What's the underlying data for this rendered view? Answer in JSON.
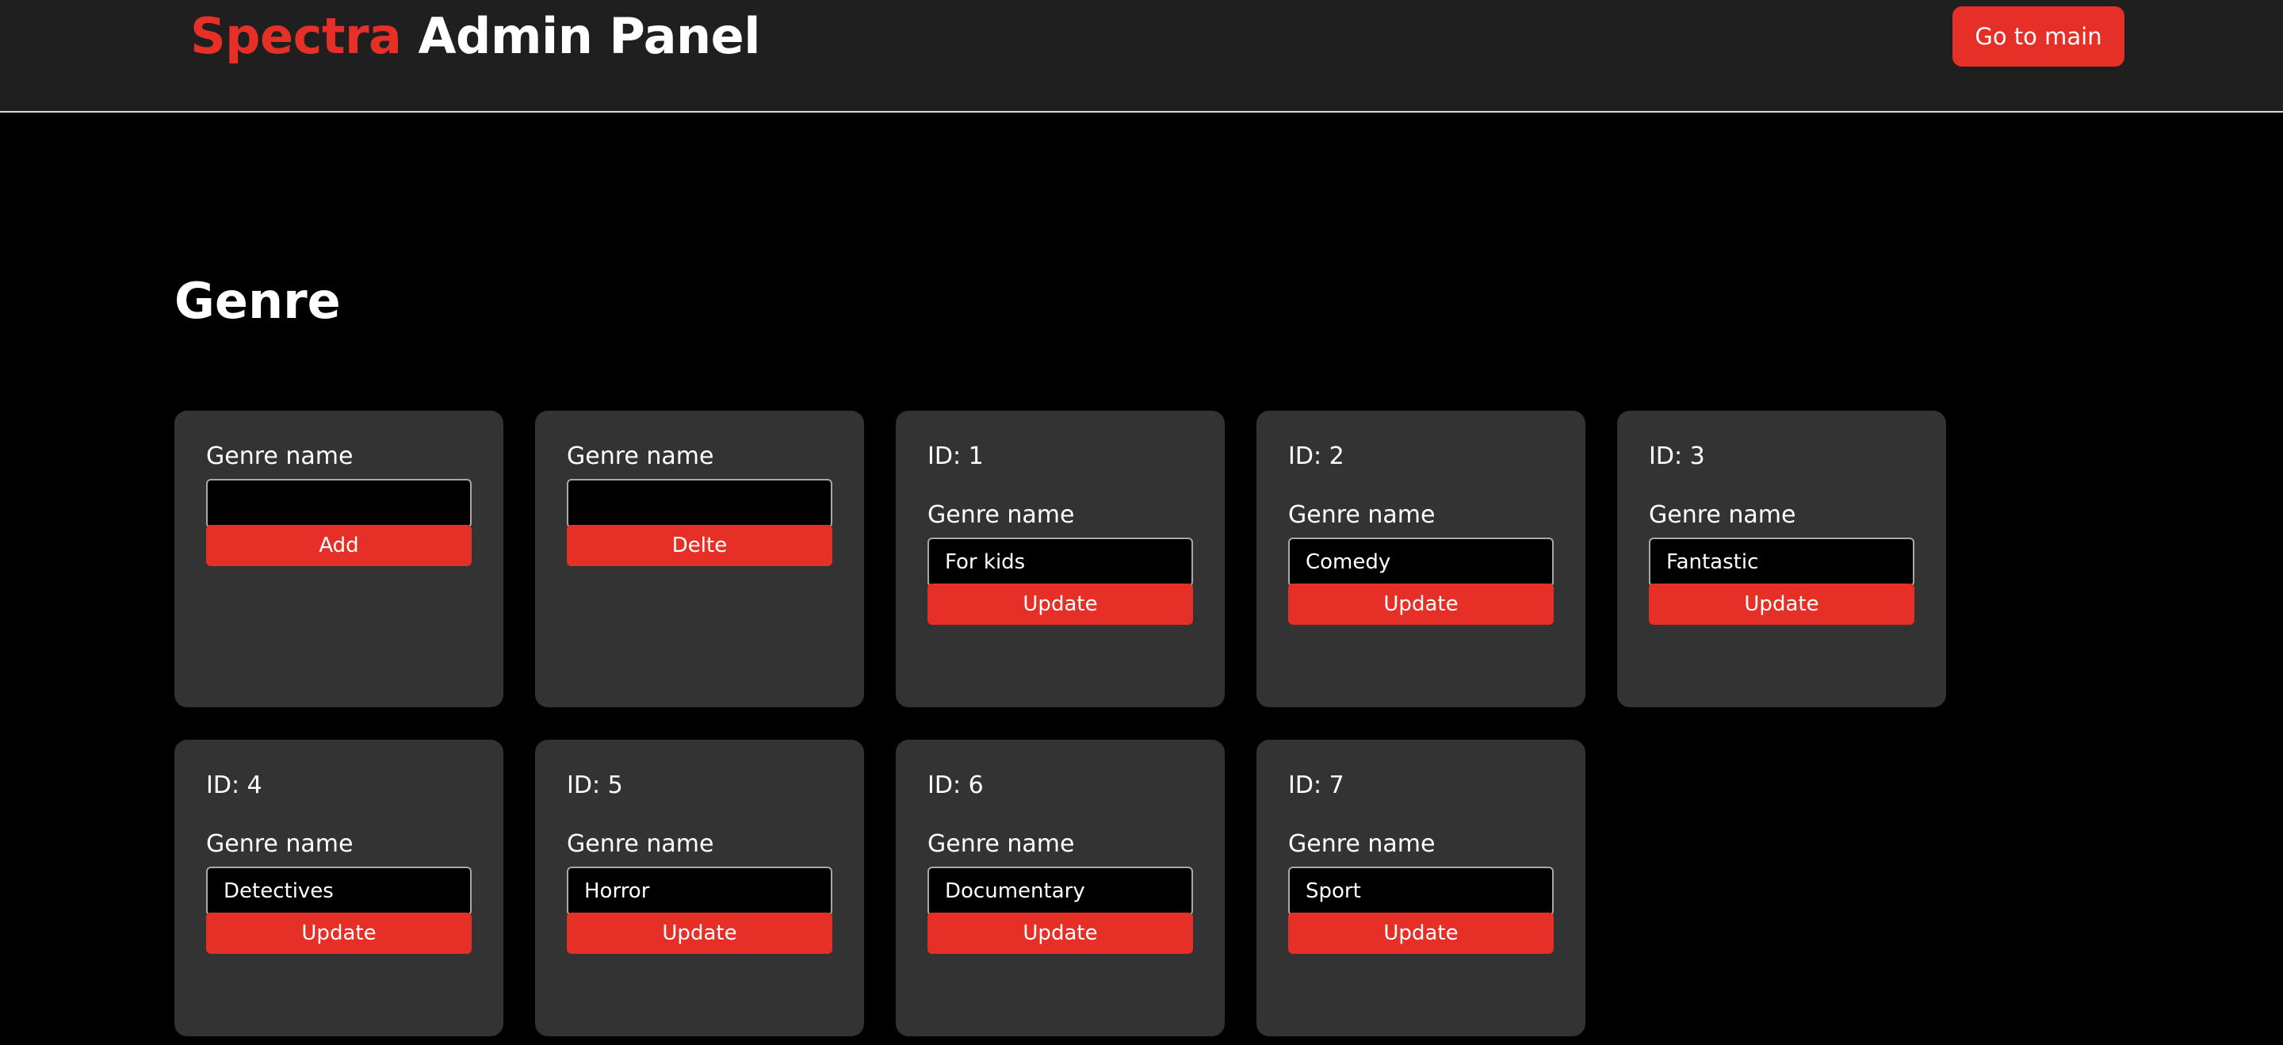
{
  "header": {
    "brand_accent": "Spectra",
    "brand_rest": "Admin Panel",
    "go_to_main_label": "Go to main"
  },
  "page": {
    "title": "Genre"
  },
  "add_card": {
    "label": "Genre name",
    "value": "",
    "button_label": "Add"
  },
  "delete_card": {
    "label": "Genre name",
    "value": "",
    "button_label": "Delte"
  },
  "genres": [
    {
      "id_label": "ID: 1",
      "name_label": "Genre name",
      "value": "For kids",
      "button_label": "Update"
    },
    {
      "id_label": "ID: 2",
      "name_label": "Genre name",
      "value": "Comedy",
      "button_label": "Update"
    },
    {
      "id_label": "ID: 3",
      "name_label": "Genre name",
      "value": "Fantastic",
      "button_label": "Update"
    },
    {
      "id_label": "ID: 4",
      "name_label": "Genre name",
      "value": "Detectives",
      "button_label": "Update"
    },
    {
      "id_label": "ID: 5",
      "name_label": "Genre name",
      "value": "Horror",
      "button_label": "Update"
    },
    {
      "id_label": "ID: 6",
      "name_label": "Genre name",
      "value": "Documentary",
      "button_label": "Update"
    },
    {
      "id_label": "ID: 7",
      "name_label": "Genre name",
      "value": "Sport",
      "button_label": "Update"
    }
  ],
  "colors": {
    "accent": "#e63027",
    "header_bg": "#1f1f1f",
    "page_bg": "#000000",
    "card_bg": "#333333"
  }
}
